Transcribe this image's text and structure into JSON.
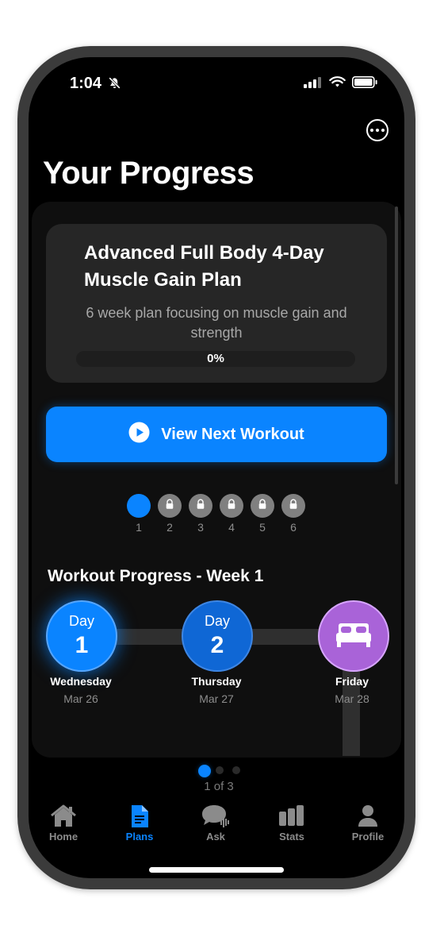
{
  "status_bar": {
    "time": "1:04",
    "bell_icon": "bell-slash-icon",
    "signal_icon": "cellular-signal-icon",
    "wifi_icon": "wifi-icon",
    "battery_icon": "battery-icon"
  },
  "header": {
    "title": "Your Progress",
    "more_icon": "ellipsis-circle-icon"
  },
  "plan_card": {
    "name": "Advanced Full Body 4-Day Muscle Gain Plan",
    "description": "6 week plan focusing on muscle gain and strength",
    "progress_text": "0%",
    "progress_value": 0
  },
  "primary_action": {
    "label": "View Next Workout",
    "icon": "play-circle-icon"
  },
  "weeks": [
    {
      "label": "1",
      "locked": false,
      "active": true
    },
    {
      "label": "2",
      "locked": true,
      "active": false
    },
    {
      "label": "3",
      "locked": true,
      "active": false
    },
    {
      "label": "4",
      "locked": true,
      "active": false
    },
    {
      "label": "5",
      "locked": true,
      "active": false
    },
    {
      "label": "6",
      "locked": true,
      "active": false
    }
  ],
  "workout_progress": {
    "title": "Workout Progress - Week 1",
    "days": [
      {
        "word": "Day",
        "number": "1",
        "weekday": "Wednesday",
        "date": "Mar 26",
        "type": "workout"
      },
      {
        "word": "Day",
        "number": "2",
        "weekday": "Thursday",
        "date": "Mar 27",
        "type": "workout"
      },
      {
        "word": "",
        "number": "",
        "weekday": "Friday",
        "date": "Mar 28",
        "type": "rest",
        "icon": "bed-icon"
      }
    ]
  },
  "pagination": {
    "label": "1 of 3",
    "current": 1,
    "total": 3
  },
  "tab_bar": [
    {
      "label": "Home",
      "icon": "house-icon",
      "active": false
    },
    {
      "label": "Plans",
      "icon": "document-icon",
      "active": true
    },
    {
      "label": "Ask",
      "icon": "chat-bubble-icon",
      "active": false
    },
    {
      "label": "Stats",
      "icon": "bar-chart-icon",
      "active": false
    },
    {
      "label": "Profile",
      "icon": "person-icon",
      "active": false
    }
  ],
  "colors": {
    "accent": "#0a84ff",
    "rest_day": "#a963d8",
    "background": "#000000"
  }
}
